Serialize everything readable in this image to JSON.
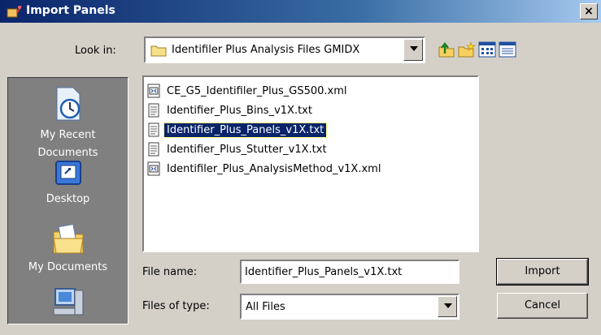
{
  "window": {
    "title": "Import Panels",
    "close_glyph": "×"
  },
  "lookin": {
    "label": "Look in:",
    "value": "Identifiler Plus Analysis Files GMIDX"
  },
  "places": [
    {
      "label": "My Recent Documents",
      "icon": "clock-document-icon"
    },
    {
      "label": "Desktop",
      "icon": "desktop-icon"
    },
    {
      "label": "My Documents",
      "icon": "folder-documents-icon"
    },
    {
      "label": "",
      "icon": "computer-icon"
    }
  ],
  "files": [
    {
      "name": "CE_G5_Identifiler_Plus_GS500.xml",
      "type": "xml",
      "selected": false
    },
    {
      "name": "Identifier_Plus_Bins_v1X.txt",
      "type": "txt",
      "selected": false
    },
    {
      "name": "Identifier_Plus_Panels_v1X.txt",
      "type": "txt",
      "selected": true
    },
    {
      "name": "Identifier_Plus_Stutter_v1X.txt",
      "type": "txt",
      "selected": false
    },
    {
      "name": "Identifiler_Plus_AnalysisMethod_v1X.xml",
      "type": "xml",
      "selected": false
    }
  ],
  "filename": {
    "label": "File name:",
    "value": "Identifier_Plus_Panels_v1X.txt"
  },
  "filetype": {
    "label": "Files of type:",
    "value": "All Files"
  },
  "buttons": {
    "import": "Import",
    "cancel": "Cancel"
  },
  "colors": {
    "title_start": "#0a246a",
    "title_end": "#a6caf0",
    "selection": "#0a246a",
    "face": "#d4d0c8",
    "places_bg": "#808080"
  }
}
